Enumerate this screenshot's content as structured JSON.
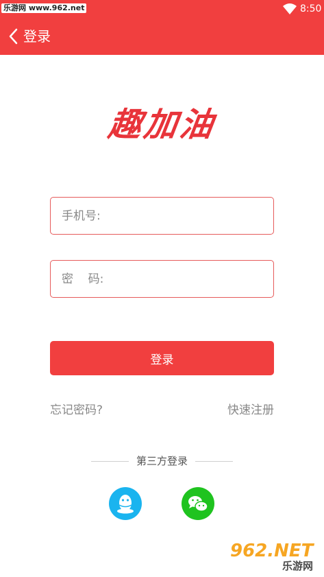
{
  "status_bar": {
    "watermark": "乐游网 www.962.net",
    "time": "8:50"
  },
  "header": {
    "title": "登录"
  },
  "logo_text": "趣加油",
  "form": {
    "phone_placeholder": "手机号:",
    "password_placeholder": "密    码:",
    "login_label": "登录"
  },
  "links": {
    "forgot": "忘记密码?",
    "register": "快速注册"
  },
  "third_party": {
    "label": "第三方登录",
    "providers": [
      "qq-icon",
      "wechat-icon"
    ]
  },
  "watermark_bottom": {
    "brand": "962.NET",
    "subtitle": "乐游网"
  },
  "colors": {
    "primary": "#f13f3f",
    "qq": "#1ab4ef",
    "wechat": "#1fc31f"
  }
}
